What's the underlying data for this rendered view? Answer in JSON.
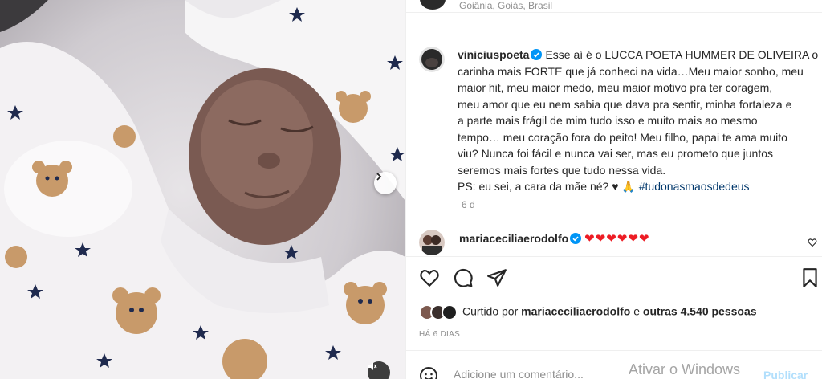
{
  "header": {
    "location": "Goiânia, Goiás, Brasil"
  },
  "post": {
    "author": "viniciuspoeta",
    "caption_lines": [
      "Esse aí é o LUCCA POETA HUMMER DE OLIVEIRA o",
      "carinha mais FORTE que já conheci na vida…Meu maior sonho, meu",
      "maior hit, meu maior medo, meu maior motivo pra ter coragem,",
      "meu amor que eu nem sabia que dava pra sentir, minha fortaleza e",
      "a parte mais frágil de mim tudo isso e muito mais ao mesmo",
      "tempo… meu coração fora do peito! Meu filho, papai te ama muito",
      "viu? Nunca foi fácil e nunca vai ser, mas eu prometo que juntos",
      "seremos mais fortes que tudo nessa vida."
    ],
    "ps_text": "PS: eu sei, a cara da mãe né? ♥ 🙏 ",
    "hashtag": "#tudonasmaosdedeus",
    "age": "6 d"
  },
  "comment": {
    "author": "mariaceciliaerodolfo",
    "text": "❤❤❤❤❤❤"
  },
  "likes": {
    "prefix": "Curtido por ",
    "user": "mariaceciliaerodolfo",
    "middle": " e ",
    "others": "outras 4.540 pessoas"
  },
  "date_label": "HÁ 6 DIAS",
  "add_comment_placeholder": "Adicione um comentário...",
  "windows_watermark": "Ativar o Windows",
  "publish_label": "Publicar",
  "colors": {
    "link": "#00376b",
    "verified": "#0095f6",
    "heart": "#ed1c24",
    "muted": "#8e8e8e"
  }
}
